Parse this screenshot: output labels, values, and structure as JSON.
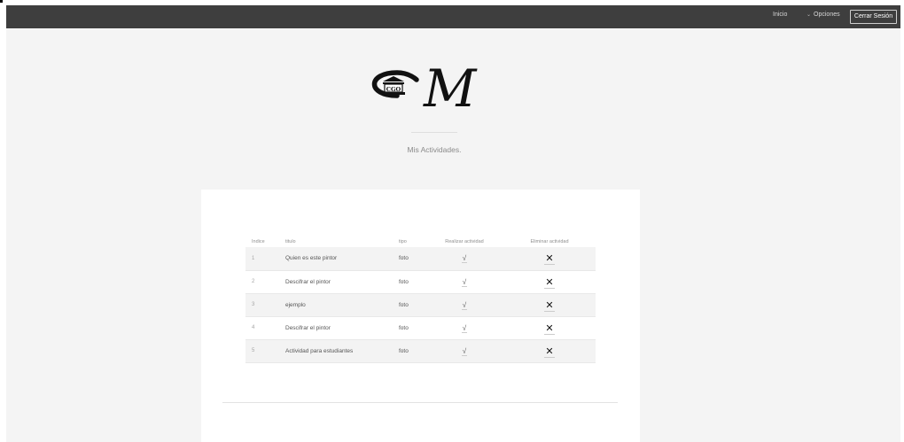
{
  "nav": {
    "inicio": "Inicio",
    "opciones": "Opciones",
    "opciones_icon": "chevron-down-icon",
    "cerrar_sesion": "Cerrar Sesión"
  },
  "logo": {
    "initials": "CGO",
    "letter": "M",
    "icon": "museum-building-icon"
  },
  "page_title": "Mis Actividades.",
  "table": {
    "headers": {
      "indice": "Indice",
      "titulo": "titulo",
      "tipo": "tipo",
      "realizar": "Realizar actividad",
      "eliminar": "Eliminar actividad"
    },
    "rows": [
      {
        "indice": "1",
        "titulo": "Quien es este pintor",
        "tipo": "foto",
        "realizar": "√",
        "eliminar": "✕"
      },
      {
        "indice": "2",
        "titulo": "Descifrar el pintor",
        "tipo": "foto",
        "realizar": "√",
        "eliminar": "✕"
      },
      {
        "indice": "3",
        "titulo": "ejemplo",
        "tipo": "foto",
        "realizar": "√",
        "eliminar": "✕"
      },
      {
        "indice": "4",
        "titulo": "Descifrar el pintor",
        "tipo": "foto",
        "realizar": "√",
        "eliminar": "✕"
      },
      {
        "indice": "5",
        "titulo": "Actividad para estudiantes",
        "tipo": "foto",
        "realizar": "√",
        "eliminar": "✕"
      }
    ]
  },
  "colors": {
    "navbar": "#3e3e3e",
    "background": "#f4f4f4",
    "card": "#ffffff"
  }
}
